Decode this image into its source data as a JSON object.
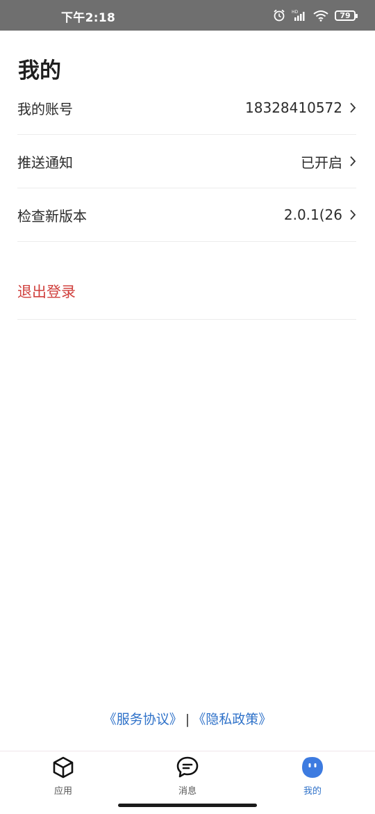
{
  "status_bar": {
    "time": "下午2:18",
    "battery": "79",
    "icons": [
      "alarm-icon",
      "signal-icon",
      "wifi-icon",
      "battery-icon"
    ]
  },
  "page": {
    "title": "我的"
  },
  "settings": {
    "items": [
      {
        "label": "我的账号",
        "value": "18328410572"
      },
      {
        "label": "推送通知",
        "value": "已开启"
      },
      {
        "label": "检查新版本",
        "value": "2.0.1(26"
      }
    ],
    "logout_label": "退出登录",
    "logout_color": "#d0403d"
  },
  "legal": {
    "service": "《服务协议》",
    "separator": "|",
    "privacy": "《隐私政策》",
    "link_color": "#2f72c9"
  },
  "tabs": [
    {
      "label": "应用",
      "icon": "cube-icon",
      "active": false
    },
    {
      "label": "消息",
      "icon": "chat-bubble-icon",
      "active": false
    },
    {
      "label": "我的",
      "icon": "profile-face-icon",
      "active": true
    }
  ]
}
